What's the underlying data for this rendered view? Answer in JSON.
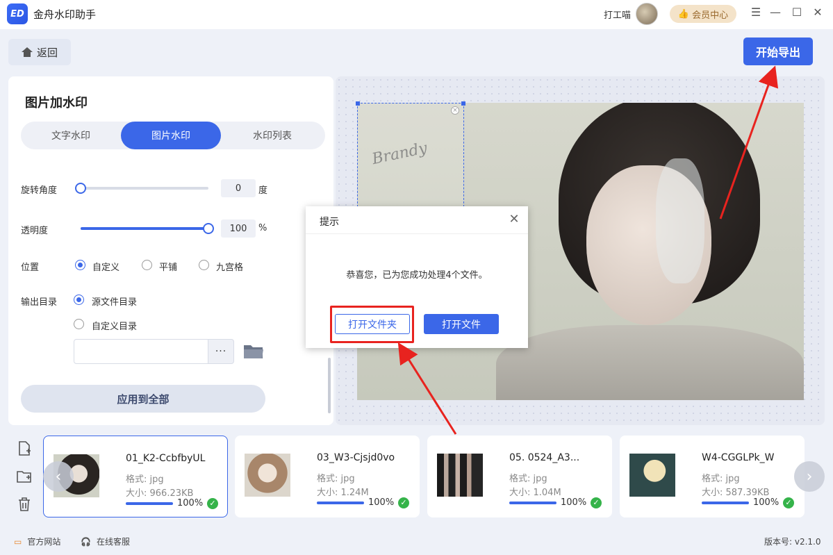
{
  "app": {
    "logo_text": "ED",
    "title": "金舟水印助手",
    "username": "打工喵",
    "vip_label": "会员中心"
  },
  "window_controls": {
    "menu": "☰",
    "minimize": "—",
    "maximize": "☐",
    "close": "✕"
  },
  "toolbar": {
    "back_label": "返回",
    "export_label": "开始导出"
  },
  "panel": {
    "title": "图片加水印",
    "tabs": [
      {
        "label": "文字水印",
        "active": false
      },
      {
        "label": "图片水印",
        "active": true
      },
      {
        "label": "水印列表",
        "active": false
      }
    ],
    "rotation": {
      "label": "旋转角度",
      "value": "0",
      "unit": "度",
      "level": 0
    },
    "opacity": {
      "label": "透明度",
      "value": "100",
      "unit": "%",
      "level": 1.0
    },
    "position": {
      "label": "位置",
      "options": [
        "自定义",
        "平铺",
        "九宫格"
      ],
      "selected": "自定义"
    },
    "output": {
      "label": "输出目录",
      "options": [
        "源文件目录",
        "自定义目录"
      ],
      "selected": "源文件目录",
      "path_value": "",
      "more_label": "···"
    },
    "apply_label": "应用到全部"
  },
  "watermark": {
    "signature_text": "Brandy"
  },
  "dialog": {
    "title": "提示",
    "close": "✕",
    "message": "恭喜您，已为您成功处理4个文件。",
    "open_folder_label": "打开文件夹",
    "open_file_label": "打开文件"
  },
  "files": [
    {
      "name": "01_K2-CcbfbyUL",
      "format": "格式: jpg",
      "size": "大小: 966.23KB",
      "progress": "100%",
      "selected": true
    },
    {
      "name": "03_W3-Cjsjd0vo",
      "format": "格式: jpg",
      "size": "大小: 1.24M",
      "progress": "100%",
      "selected": false
    },
    {
      "name": "05. 0524_A3...",
      "format": "格式: jpg",
      "size": "大小: 1.04M",
      "progress": "100%",
      "selected": false
    },
    {
      "name": "W4-CGGLPk_W",
      "format": "格式: jpg",
      "size": "大小: 587.39KB",
      "progress": "100%",
      "selected": false
    }
  ],
  "footer": {
    "website": "官方网站",
    "support": "在线客服",
    "version": "版本号: v2.1.0"
  },
  "colors": {
    "accent": "#3b67e8",
    "highlight": "#e8231f",
    "success": "#35b34a"
  }
}
